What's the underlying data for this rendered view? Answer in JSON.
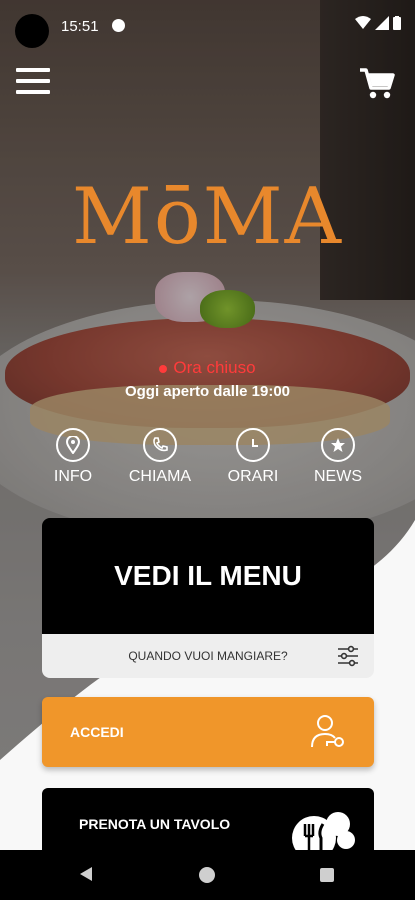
{
  "status_bar": {
    "time": "15:51"
  },
  "brand": {
    "logo": "MōMA",
    "accent": "#e8882c"
  },
  "store_status": {
    "state": "Ora chiuso",
    "hours": "Oggi aperto dalle 19:00",
    "state_color": "#ff3b3b"
  },
  "quick_actions": [
    {
      "label": "INFO",
      "icon": "location-pin-icon"
    },
    {
      "label": "CHIAMA",
      "icon": "phone-icon"
    },
    {
      "label": "ORARI",
      "icon": "clock-icon"
    },
    {
      "label": "NEWS",
      "icon": "star-bubble-icon"
    }
  ],
  "menu_card": {
    "title": "VEDI IL MENU",
    "when_prompt": "QUANDO VUOI MANGIARE?"
  },
  "login": {
    "label": "ACCEDI",
    "color": "#f0962a"
  },
  "booking": {
    "label": "PRENOTA UN TAVOLO"
  }
}
